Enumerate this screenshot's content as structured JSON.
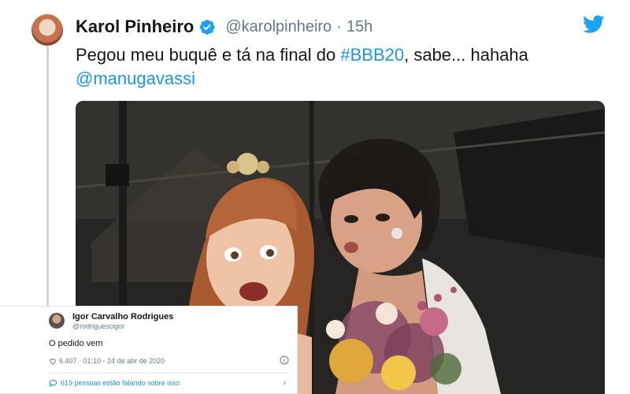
{
  "tweet": {
    "author_name": "Karol Pinheiro",
    "handle": "@karolpinheiro",
    "separator": "·",
    "time": "15h",
    "text_before": "Pegou meu buquê e tá na final do ",
    "hashtag": "#BBB20",
    "text_after": ", sabe... hahaha",
    "mention": "@manugavassi"
  },
  "embedded_tweet": {
    "author_name": "Igor Carvalho Rodrigues",
    "handle": "@rodriguescigor",
    "text": "O pedido vem",
    "likes": "6.407",
    "timestamp": "01:10 - 24 de abr de 2020",
    "discussion": "619 pessoas estão falando sobre isso"
  },
  "colors": {
    "link": "#1b95e0",
    "secondary_text": "#657786",
    "twitter_blue": "#1da1f2"
  },
  "icons": [
    "verified-badge-icon",
    "twitter-bird-icon",
    "heart-icon",
    "info-icon",
    "comment-icon",
    "chevron-right-icon"
  ]
}
